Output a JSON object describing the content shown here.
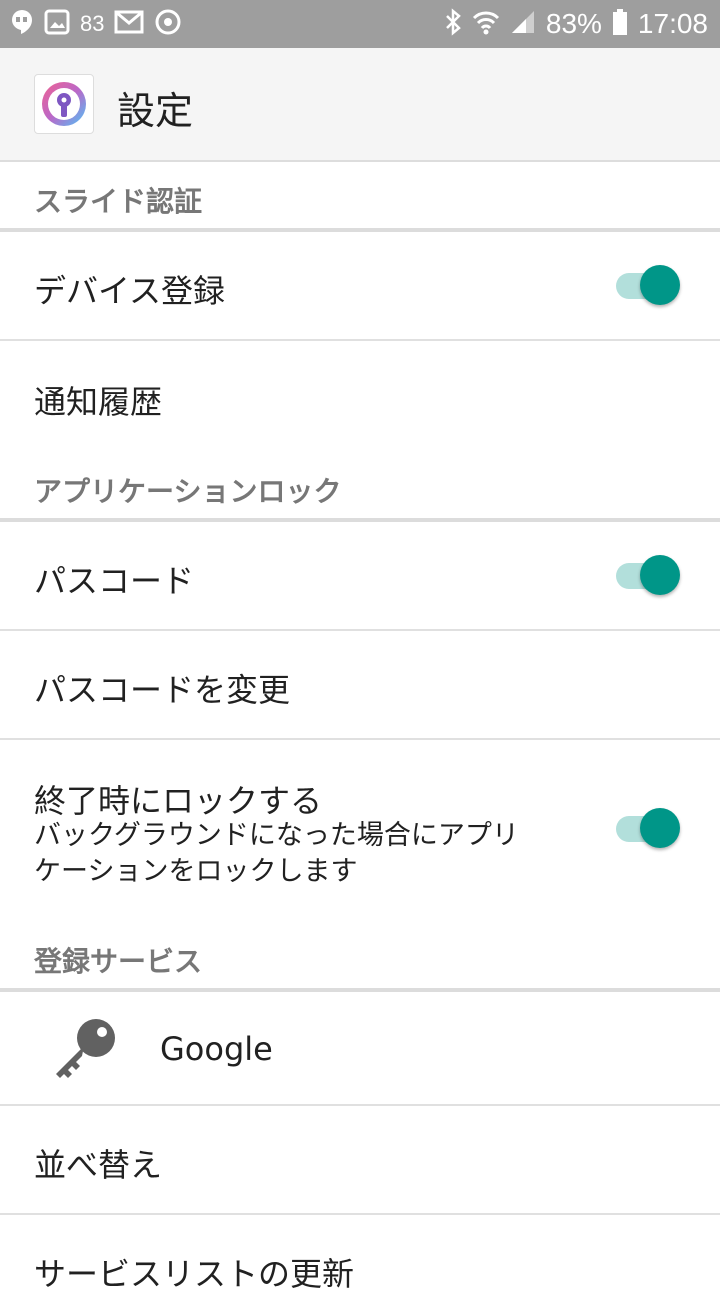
{
  "status_bar": {
    "notification_count": "83",
    "battery_percent": "83%",
    "time": "17:08"
  },
  "app_bar": {
    "title": "設定"
  },
  "sections": {
    "slide_auth": {
      "header": "スライド認証",
      "device_register": {
        "label": "デバイス登録",
        "enabled": true
      },
      "notification_history": {
        "label": "通知履歴"
      }
    },
    "app_lock": {
      "header": "アプリケーションロック",
      "passcode": {
        "label": "パスコード",
        "enabled": true
      },
      "change_passcode": {
        "label": "パスコードを変更"
      },
      "lock_on_exit": {
        "label": "終了時にロックする",
        "sub_line1": "バックグラウンドになった場合にアプリ",
        "sub_line2": "ケーションをロックします",
        "enabled": true
      }
    },
    "registered_services": {
      "header": "登録サービス",
      "services": [
        {
          "name": "Google",
          "icon": "key-icon"
        }
      ],
      "reorder": {
        "label": "並べ替え"
      },
      "refresh_list": {
        "label": "サービスリストの更新"
      }
    }
  },
  "colors": {
    "accent": "#009688",
    "accent_track": "#b2dfdb",
    "status_bar": "#9e9e9e",
    "section_header_text": "#777777"
  }
}
